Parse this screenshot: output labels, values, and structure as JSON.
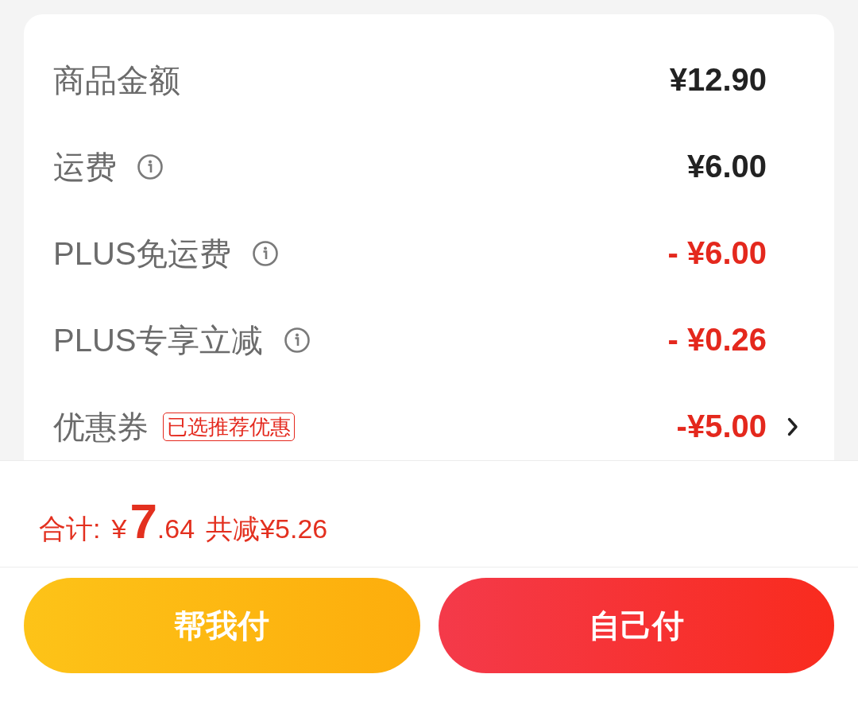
{
  "summary": {
    "rows": [
      {
        "label": "商品金额",
        "info": false,
        "value": "¥12.90",
        "discount": false,
        "arrow": false
      },
      {
        "label": "运费",
        "info": true,
        "value": "¥6.00",
        "discount": false,
        "arrow": false
      },
      {
        "label": "PLUS免运费",
        "info": true,
        "value": "- ¥6.00",
        "discount": true,
        "arrow": false
      },
      {
        "label": "PLUS专享立减",
        "info": true,
        "value": "- ¥0.26",
        "discount": true,
        "arrow": false
      },
      {
        "label": "优惠券",
        "info": false,
        "badge": "已选推荐优惠",
        "value": "-¥5.00",
        "discount": true,
        "arrow": true
      }
    ]
  },
  "total": {
    "label": "合计:",
    "currency": "¥",
    "integer": "7",
    "decimal": ".64",
    "savings": "共减¥5.26"
  },
  "buttons": [
    {
      "label": "帮我付",
      "kind": "secondary"
    },
    {
      "label": "自己付",
      "kind": "primary"
    }
  ]
}
